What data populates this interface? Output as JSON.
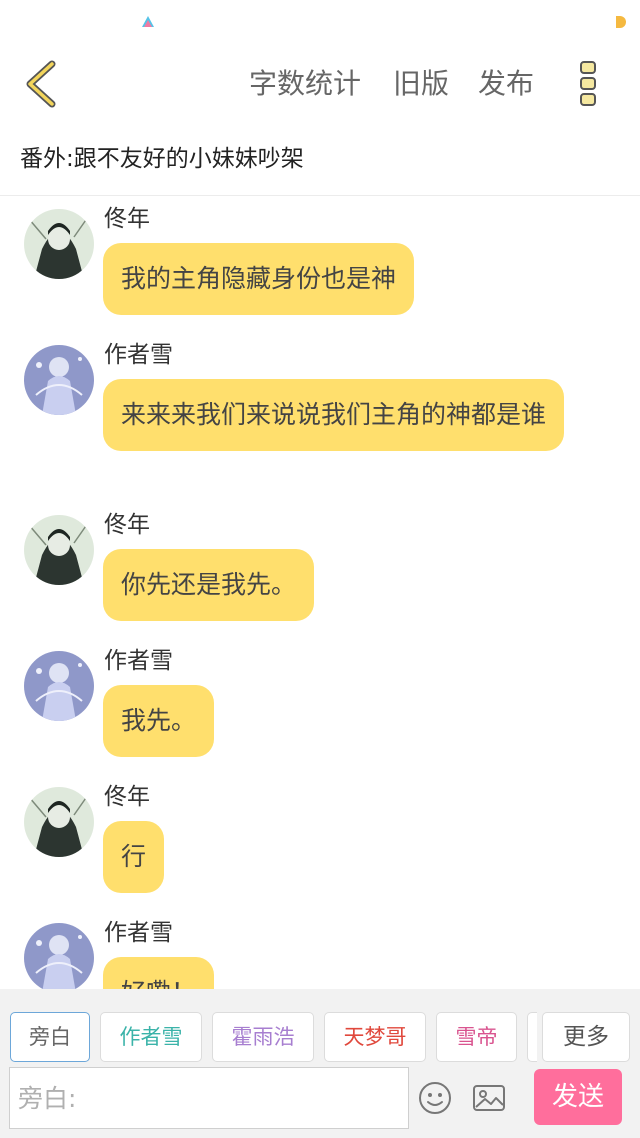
{
  "toolbar": {
    "word_count": "字数统计",
    "old_version": "旧版",
    "publish": "发布"
  },
  "chapter_title": "番外:跟不友好的小妹妹吵架",
  "messages": [
    {
      "sender": "佟年",
      "text": "我的主角隐藏身份也是神",
      "avatar": "avatar-tongnian"
    },
    {
      "sender": "作者雪",
      "text": "来来来我们来说说我们主角的神都是谁",
      "avatar": "avatar-author"
    },
    {
      "sender": "佟年",
      "text": "你先还是我先。",
      "avatar": "avatar-tongnian"
    },
    {
      "sender": "作者雪",
      "text": "我先。",
      "avatar": "avatar-author"
    },
    {
      "sender": "佟年",
      "text": "行",
      "avatar": "avatar-tongnian"
    },
    {
      "sender": "作者雪",
      "text": "好嘞！",
      "avatar": "avatar-author"
    }
  ],
  "roles": [
    {
      "label": "旁白",
      "color": "#666666",
      "selected": true
    },
    {
      "label": "作者雪",
      "color": "#3bb3a9",
      "selected": false
    },
    {
      "label": "霍雨浩",
      "color": "#a77ed0",
      "selected": false
    },
    {
      "label": "天梦哥",
      "color": "#e0483c",
      "selected": false
    },
    {
      "label": "雪帝",
      "color": "#d9548f",
      "selected": false
    }
  ],
  "more_roles": "更多",
  "input": {
    "placeholder": "旁白:",
    "value": ""
  },
  "send_label": "发送",
  "icons": {
    "back": "chevron-left-icon",
    "menu": "more-vertical-icon",
    "emoji": "smiley-icon",
    "image": "image-icon"
  },
  "colors": {
    "bubble": "#ffdf6d",
    "send": "#ff6e9c",
    "accent": "#f5b940"
  }
}
